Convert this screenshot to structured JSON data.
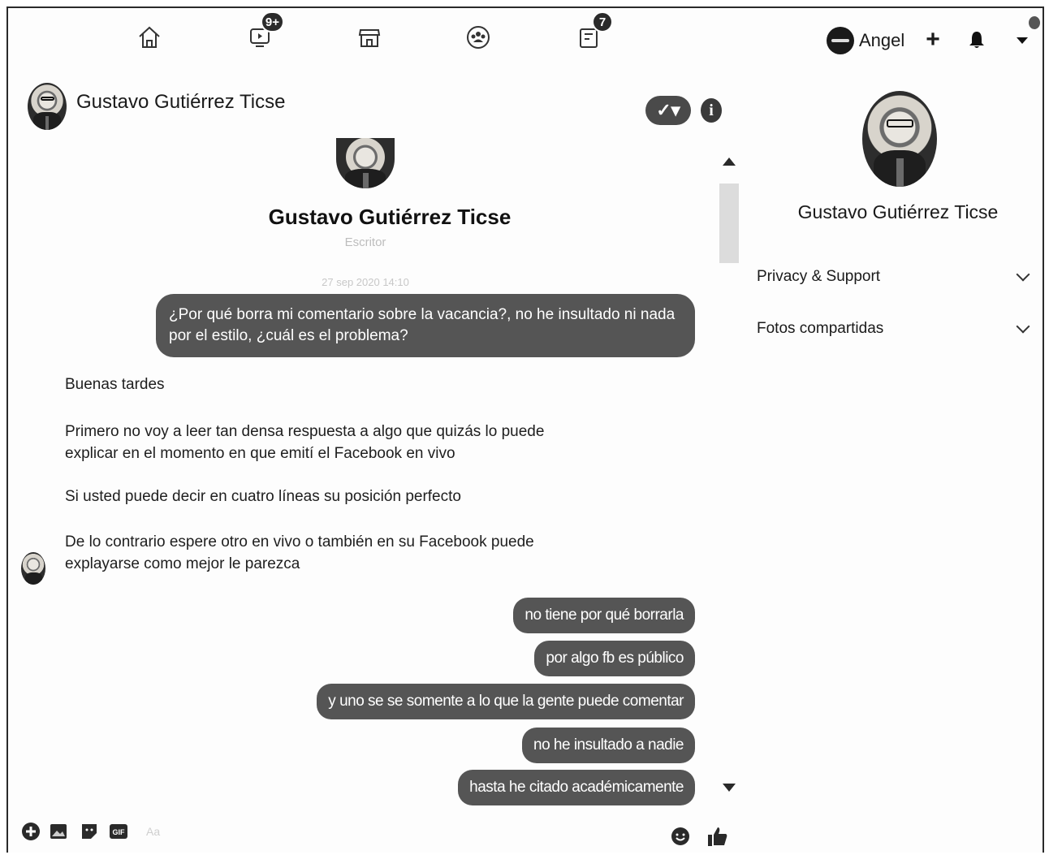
{
  "topnav": {
    "icons": [
      {
        "name": "home-icon"
      },
      {
        "name": "watch-icon",
        "badge": "9+"
      },
      {
        "name": "marketplace-icon"
      },
      {
        "name": "groups-icon"
      },
      {
        "name": "gaming-icon",
        "badge": "7"
      }
    ],
    "user_name": "Angel",
    "create_label": "+",
    "notifications_icon": "bell-icon",
    "menu_icon": "caret-down-icon"
  },
  "chat": {
    "title": "Gustavo Gutiérrez Ticse",
    "check_label": "✓▾",
    "info_label": "i"
  },
  "profile": {
    "name": "Gustavo Gutiérrez Ticse",
    "role": "Escritor",
    "timestamp": "27 sep 2020 14:10"
  },
  "messages": {
    "first_outgoing": "¿Por qué borra mi comentario sobre la vacancia?, no he insultado ni nada por el estilo, ¿cuál es el problema?",
    "incoming": [
      "Buenas tardes",
      "Primero no voy a leer tan densa respuesta a algo que quizás lo puede explicar en el momento en que emití el Facebook en vivo",
      "Si usted puede decir en cuatro líneas su posición perfecto",
      "De lo contrario espere otro en vivo o también en su Facebook puede explayarse como mejor le parezca"
    ],
    "outgoing": [
      "no tiene por qué borrarla",
      "por algo fb es público",
      "y uno se se somente a lo que la gente puede comentar",
      "no he insultado a nadie",
      "hasta he citado académicamente"
    ]
  },
  "composer": {
    "placeholder": "Aa",
    "gif_label": "GIF"
  },
  "panel": {
    "name": "Gustavo Gutiérrez Ticse",
    "sections": [
      "Privacy & Support",
      "Fotos compartidas"
    ]
  }
}
